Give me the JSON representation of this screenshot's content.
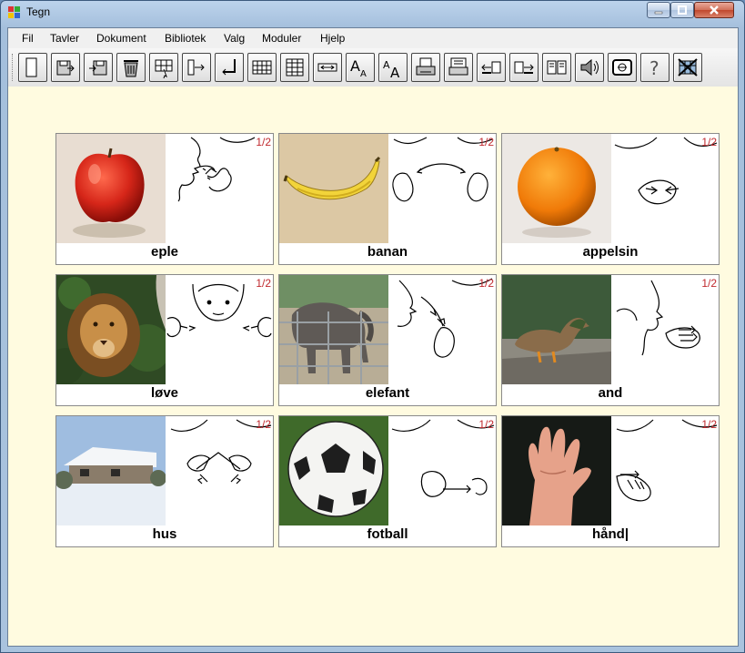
{
  "window": {
    "title": "Tegn"
  },
  "menu": [
    {
      "label": "Fil"
    },
    {
      "label": "Tavler"
    },
    {
      "label": "Dokument"
    },
    {
      "label": "Bibliotek"
    },
    {
      "label": "Valg"
    },
    {
      "label": "Moduler"
    },
    {
      "label": "Hjelp"
    }
  ],
  "toolbar": {
    "buttons": [
      {
        "icon": "new-document-icon"
      },
      {
        "icon": "save-icon"
      },
      {
        "icon": "save-as-icon"
      },
      {
        "icon": "delete-icon"
      },
      {
        "icon": "grid-select-icon"
      },
      {
        "icon": "insert-before-icon"
      },
      {
        "icon": "insert-after-icon"
      },
      {
        "icon": "table-icon"
      },
      {
        "icon": "table-props-icon"
      },
      {
        "icon": "resize-icon"
      },
      {
        "icon": "font-size-up-icon"
      },
      {
        "icon": "font-size-down-icon"
      },
      {
        "icon": "print-icon"
      },
      {
        "icon": "print-preview-icon"
      },
      {
        "icon": "move-left-icon"
      },
      {
        "icon": "move-right-icon"
      },
      {
        "icon": "library-icon"
      },
      {
        "icon": "speaker-icon"
      },
      {
        "icon": "image-icon"
      },
      {
        "icon": "help-icon"
      },
      {
        "icon": "exit-icon"
      }
    ]
  },
  "page_tag": "1/2",
  "cards": [
    {
      "word": "eple",
      "photo": "apple"
    },
    {
      "word": "banan",
      "photo": "banana"
    },
    {
      "word": "appelsin",
      "photo": "orange"
    },
    {
      "word": "løve",
      "photo": "lion"
    },
    {
      "word": "elefant",
      "photo": "elephant"
    },
    {
      "word": "and",
      "photo": "duck"
    },
    {
      "word": "hus",
      "photo": "house"
    },
    {
      "word": "fotball",
      "photo": "football"
    },
    {
      "word": "hånd|",
      "photo": "hand"
    }
  ],
  "colors": {
    "board_bg": "#fffbe0",
    "page_tag": "#c0282d"
  }
}
